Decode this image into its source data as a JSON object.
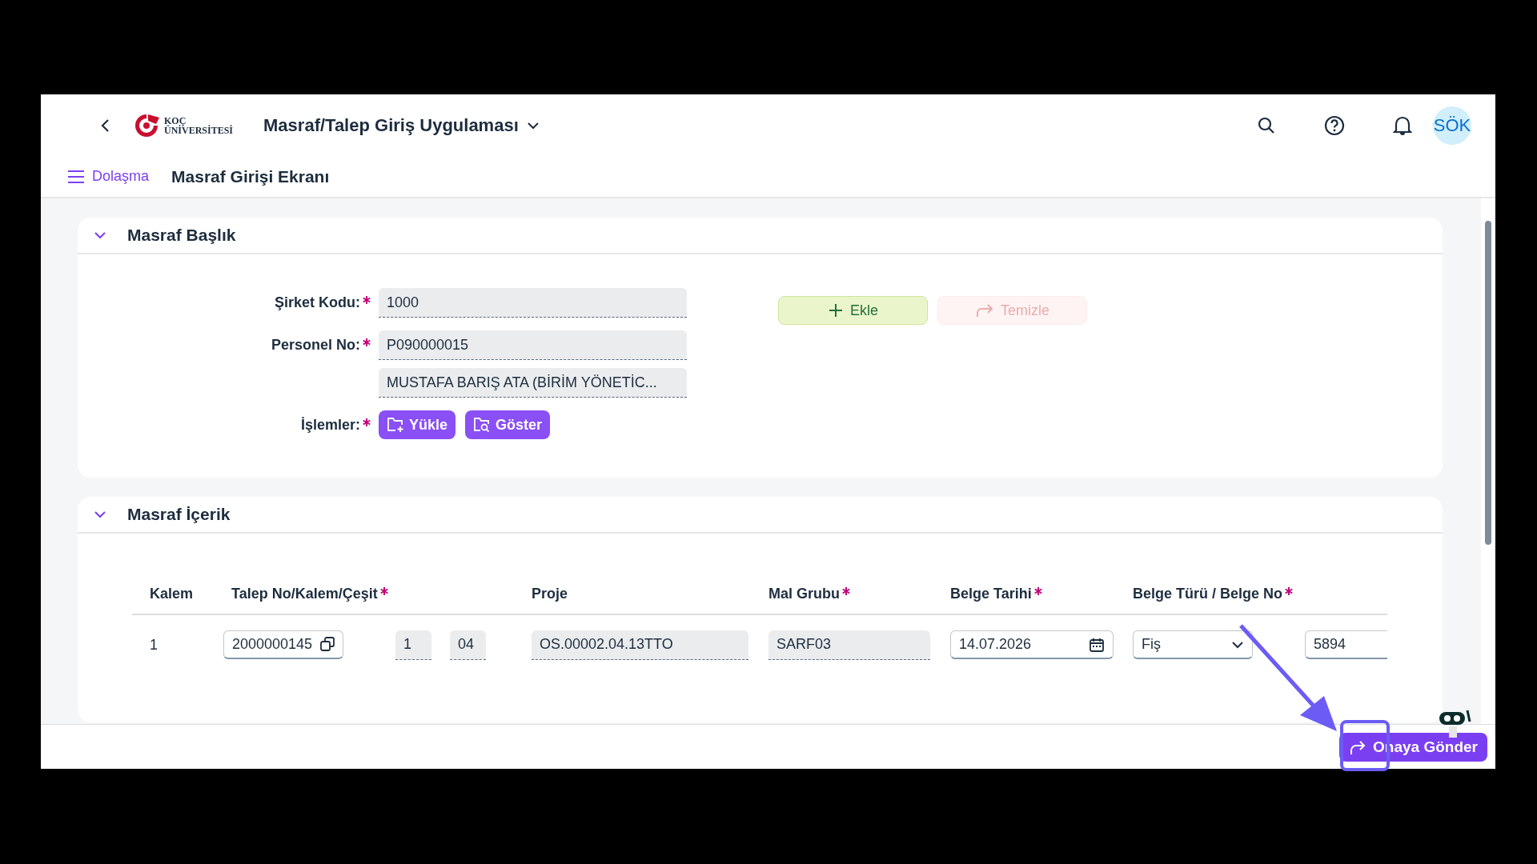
{
  "shell": {
    "logo": {
      "line1": "KOÇ",
      "line2": "ÜNİVERSİTESİ"
    },
    "app_title": "Masraf/Talep Giriş Uygulaması",
    "avatar": "SÖK"
  },
  "nav": {
    "menu_label": "Dolaşma",
    "page_title": "Masraf Girişi Ekranı"
  },
  "header_section": {
    "title": "Masraf Başlık",
    "expanded": true,
    "fields": [
      {
        "label": "Şirket Kodu:",
        "required": true,
        "values": [
          "1000"
        ]
      },
      {
        "label": "Personel No:",
        "required": true,
        "values": [
          "P090000015",
          "MUSTAFA BARIŞ  ATA (BİRİM YÖNETİC..."
        ]
      }
    ],
    "actions": {
      "label": "İşlemler:",
      "required": true,
      "buttons": [
        {
          "label": "Yükle",
          "kind": "upload"
        },
        {
          "label": "Göster",
          "kind": "show"
        }
      ]
    },
    "buttons": [
      {
        "label": "Ekle",
        "kind": "add",
        "disabled": false
      },
      {
        "label": "Temizle",
        "kind": "clear",
        "disabled": true
      }
    ]
  },
  "content_section": {
    "title": "Masraf İçerik",
    "expanded": true,
    "columns": [
      {
        "label": "Kalem",
        "required": false
      },
      {
        "label": "Talep No/Kalem/Çeşit",
        "required": true
      },
      {
        "label": "Proje",
        "required": false
      },
      {
        "label": "Mal Grubu",
        "required": true
      },
      {
        "label": "Belge Tarihi",
        "required": true
      },
      {
        "label": "Belge Türü / Belge No",
        "required": true
      }
    ],
    "rows": [
      {
        "cells": [
          {
            "kind": "text",
            "value": "1"
          },
          {
            "kind": "request-group",
            "values": [
              "2000000145",
              "1",
              "04"
            ]
          },
          {
            "kind": "readonly",
            "value": "OS.00002.04.13TTO"
          },
          {
            "kind": "readonly",
            "value": "SARF03"
          },
          {
            "kind": "date-input",
            "value": "14.07.2026"
          },
          {
            "kind": "document-group",
            "values": [
              "Fiş",
              "5894"
            ]
          }
        ]
      }
    ]
  },
  "footer": {
    "submit": "Onaya Gönder",
    "highlighted": true
  }
}
